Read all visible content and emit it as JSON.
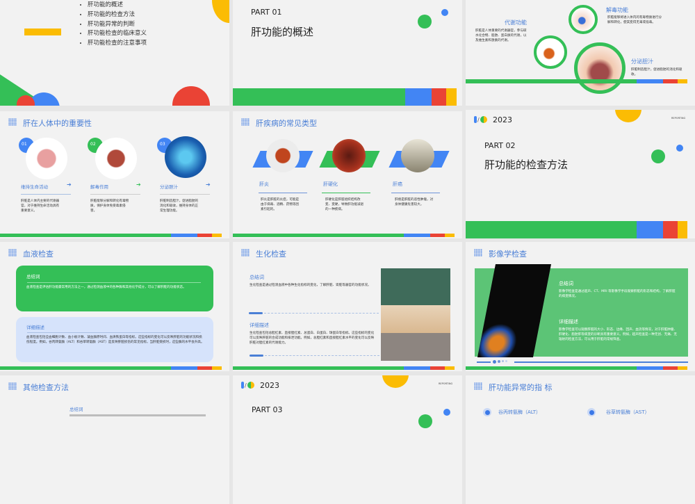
{
  "slides": {
    "toc": {
      "items": [
        "肝功能的概述",
        "肝功能的检查方法",
        "肝功能异常的判断",
        "肝功能检查的临床意义",
        "肝功能检查的注意事项"
      ]
    },
    "part01": {
      "part": "PART 01",
      "title": "肝功能的概述"
    },
    "functions": {
      "metabolism": {
        "title": "代谢功能",
        "text": "肝脏是人体重要的代谢器官，参与碳水化合物、脂肪、蛋白质的代谢，以及维生素和激素的代谢。"
      },
      "detox": {
        "title": "解毒功能",
        "text": "肝脏能够将进入体内的有毒物质进行分解和转化，使其变得无毒或低毒。"
      },
      "bile": {
        "title": "分泌胆汁",
        "text": "肝脏制造胆汁，促进脂肪的消化和吸收。"
      }
    },
    "importance": {
      "title": "肝在人体中的重要性",
      "items": [
        {
          "num": "01",
          "label": "维持生命活动",
          "text": "肝脏是人体内主要的代谢器官，对于维持生命活动具有重要意义。"
        },
        {
          "num": "02",
          "label": "解毒作用",
          "text": "肝脏能够分解和转化有毒物质，保护身体免受毒素侵害。"
        },
        {
          "num": "03",
          "label": "分泌胆汁",
          "text": "肝脏制造胆汁，促进脂肪的消化和吸收，维持身体的正常生理功能。"
        }
      ]
    },
    "diseases": {
      "title": "肝疾病的常见类型",
      "items": [
        {
          "label": "肝炎",
          "text": "肝炎是肝脏的炎症，可能是由于病毒、酒精、药物等因素引起的。"
        },
        {
          "label": "肝硬化",
          "text": "肝硬化是肝脏组织结构改变、变硬，导致肝功能减退的一种疾病。"
        },
        {
          "label": "肝癌",
          "text": "肝癌是肝脏的恶性肿瘤，对身体健康危害较大。"
        }
      ]
    },
    "part02": {
      "year": "2023",
      "tag": "REPORTING",
      "part": "PART 02",
      "title": "肝功能的检查方法"
    },
    "blood": {
      "title": "血液检查",
      "summary_title": "总结词",
      "summary": "血液检查是评估肝功能最常用的方法之一，通过检测血液中的各种酶和其他化学成分，可以了解肝脏的功能状态。",
      "detail_title": "详细描述",
      "detail": "血液检查包括全血细胞计数、血小板计数、凝血酶原时间、血清铁蛋白等指标。这些指标的变化可以反映肝脏的功能状况和损伤程度。例如，谷丙转氨酶（ALT）和谷草转氨酶（AST）是反映肝脏损伤的常见指标，当肝脏受损时，这些酶的水平会升高。"
    },
    "biochem": {
      "title": "生化检查",
      "summary_title": "总结词",
      "summary": "生化检查是通过检测血液中各种生化指标的变化，了解肝脏、肾脏等器官的功能状况。",
      "detail_title": "详细描述",
      "detail": "生化检查包括总胆红素、直接胆红素、总蛋白、白蛋白、球蛋白等指标。这些指标的变化可以反映肝脏的合成功能和排泄功能。例如，总胆红素和直接胆红素水平的变化可以反映肝脏对胆红素的代谢能力。"
    },
    "imaging": {
      "title": "影像学检查",
      "summary_title": "总结词",
      "summary": "影像学检查是通过超声、CT、MRI 等影像学手段观察肝脏的形态和结构，了解肝脏的病变情况。",
      "detail_title": "详细描述",
      "detail": "影像学检查可以观察肝脏的大小、形态、边缘、回声、血流等情况，对于肝脏肿瘤、肝硬化、脂肪肝等病变的诊断具有重要意义。例如，超声检查是一种无创、无痛、无辐射的检查方法，可以用于肝脏的常规筛查。"
    },
    "other": {
      "title": "其他检查方法",
      "summary_title": "总结词"
    },
    "part03": {
      "year": "2023",
      "tag": "REPORTING",
      "part": "PART 03"
    },
    "indicators": {
      "title": "肝功能异常的指 标",
      "items": [
        "谷丙转氨酶（ALT）",
        "谷草转氨酶（AST）"
      ]
    }
  },
  "colors": {
    "green": "#34bf57",
    "blue": "#4285f4",
    "red": "#ea4335",
    "yellow": "#fbbc04"
  }
}
